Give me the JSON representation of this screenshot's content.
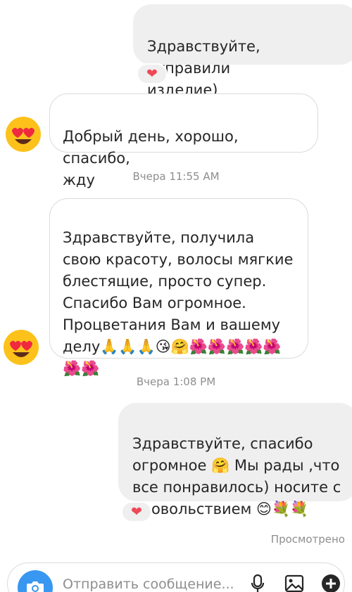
{
  "messages": [
    {
      "text": "Здравствуйте, отправили\nизделие)"
    },
    {
      "text": "Добрый день, хорошо, спасибо,\nжду"
    },
    {
      "text": "Здравствуйте, получила\nсвою красоту, волосы мягкие\nблестящие, просто супер.\nСпасибо Вам огромное.\nПроцветания Вам и вашему\nделу🙏🙏🙏😘🤗🌺🌺🌺🌺🌺\n🌺🌺"
    },
    {
      "text": "Здравствуйте, спасибо\nогромное  🤗 Мы рады ,что\nвсе понравилось)  носите с\nудовольствием 😊💐💐"
    }
  ],
  "reactions": {
    "emoji": "❤️",
    "color": "#ed4956"
  },
  "timestamps": [
    "Вчера 11:55 AM",
    "Вчера 1:08 PM"
  ],
  "seen_label": "Просмотрено",
  "composer": {
    "placeholder": "Отправить сообщение..."
  },
  "icons": [
    "heart-eyes-avatar-icon",
    "camera-icon",
    "microphone-icon",
    "gallery-icon",
    "plus-icon"
  ],
  "colors": {
    "outgoing_bubble": "#efefef",
    "incoming_border": "#dbdbdb",
    "meta_text": "#8e8e8e",
    "camera_button": "#3897f0"
  }
}
